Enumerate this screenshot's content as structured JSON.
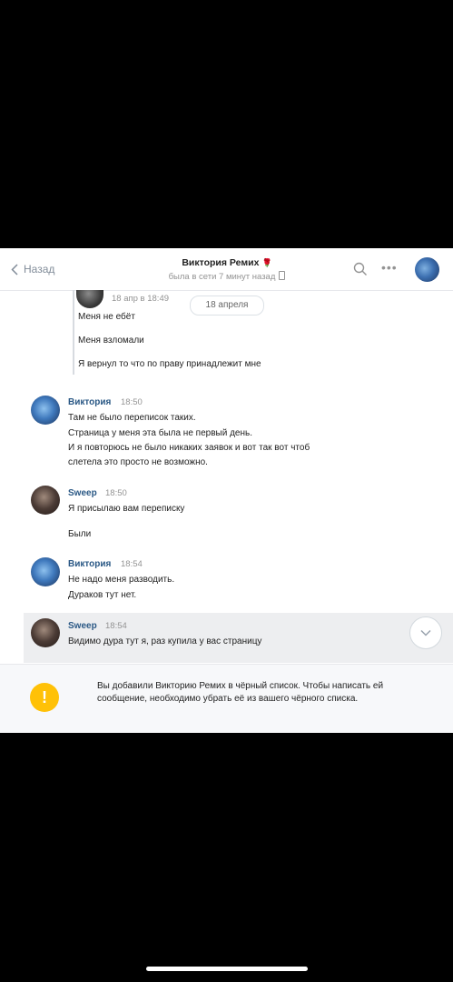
{
  "header": {
    "back_label": "Назад",
    "title": "Виктория Ремих",
    "rose": "🌹",
    "status": "была в сети 7 минут назад"
  },
  "forwarded": {
    "time": "18 апр в 18:49",
    "date_pill": "18 апреля",
    "lines": [
      "Меня не ебёт",
      "Меня взломали",
      "Я вернул то что по праву принадлежит мне"
    ]
  },
  "messages": [
    {
      "author": "Виктория",
      "time": "18:50",
      "lines": [
        "Там не было переписок таких.",
        "Страница у меня эта была не первый день.",
        "И я повторюсь не было никаких заявок и вот так вот чтоб",
        "слетела это просто не возможно."
      ]
    },
    {
      "author": "Sweep",
      "time": "18:50",
      "lines": [
        "Я присылаю вам переписку",
        "Были"
      ]
    },
    {
      "author": "Виктория",
      "time": "18:54",
      "lines": [
        "Не надо меня разводить.",
        "Дураков тут нет."
      ]
    },
    {
      "author": "Sweep",
      "time": "18:54",
      "lines": [
        "Видимо дура тут я, раз купила у вас страницу"
      ]
    }
  ],
  "notice": {
    "text": "Вы добавили Викторию Ремих в чёрный список. Чтобы написать ей сообщение, необходимо убрать её из вашего чёрного списка."
  },
  "colors": {
    "accent": "#2a5885",
    "warning": "#ffc107",
    "highlight": "#edeef0"
  }
}
